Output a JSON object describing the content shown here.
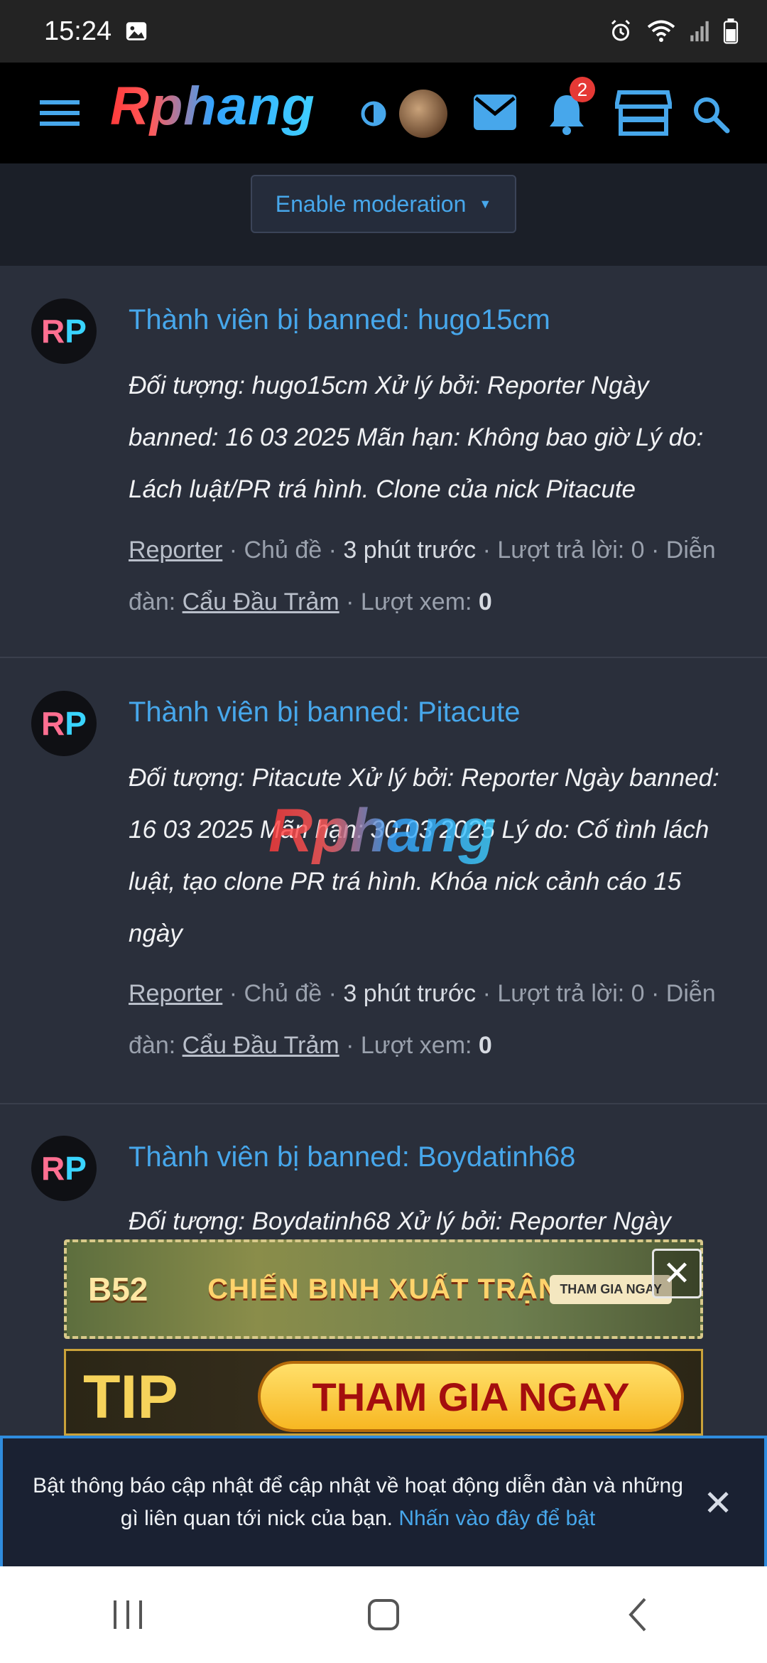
{
  "status_bar": {
    "time": "15:24"
  },
  "top_nav": {
    "logo_text": "Rphang",
    "notification_count": "2"
  },
  "moderation": {
    "button_label": "Enable moderation"
  },
  "threads": [
    {
      "title": "Thành viên bị banned: hugo15cm",
      "snippet": "Đối tượng: hugo15cm Xử lý bởi: Reporter Ngày banned: 16 03 2025 Mãn hạn: Không bao giờ Lý do: Lách luật/PR trá hình. Clone của nick Pitacute",
      "author": "Reporter",
      "sep1": " · Chủ đề · ",
      "time": "3 phút trước",
      "sep2": " · Lượt trả lời: 0 · Diễn đàn: ",
      "forum": "Cẩu Đầu Trảm",
      "views_label": " · Lượt xem: ",
      "views": "0"
    },
    {
      "title": "Thành viên bị banned: Pitacute",
      "snippet": "Đối tượng: Pitacute Xử lý bởi: Reporter Ngày banned: 16 03 2025 Mãn hạn: 30 03 2025 Lý do: Cố tình lách luật, tạo clone PR trá hình. Khóa nick cảnh cáo 15 ngày",
      "author": "Reporter",
      "sep1": " · Chủ đề · ",
      "time": "3 phút trước",
      "sep2": " · Lượt trả lời: 0 · Diễn đàn: ",
      "forum": "Cẩu Đầu Trảm",
      "views_label": " · Lượt xem: ",
      "views": "0"
    },
    {
      "title": "Thành viên bị banned: Boydatinh68",
      "snippet": "Đối tượng: Boydatinh68 Xử lý bởi: Reporter Ngày"
    }
  ],
  "watermark": "Rphang",
  "ads": {
    "ad1_brand": "B52",
    "ad1_text": "CHIẾN BINH XUẤT TRẬN",
    "ad1_cta": "THAM GIA NGAY",
    "ad2_brand": "TIP",
    "ad2_cta": "THAM GIA NGAY"
  },
  "notice": {
    "text": "Bật thông báo cập nhật để cập nhật về hoạt động diễn đàn và những gì liên quan tới nick của bạn.",
    "link": "Nhấn vào đây để bật"
  },
  "colors": {
    "accent": "#47a7eb",
    "background": "#2a2f3b"
  }
}
